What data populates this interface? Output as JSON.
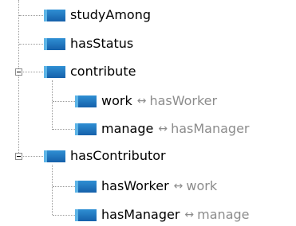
{
  "tree": {
    "inverse_arrow": "↔",
    "items": [
      {
        "label": "studyAmong"
      },
      {
        "label": "hasStatus"
      },
      {
        "label": "contribute",
        "expanded": true,
        "children": [
          {
            "label": "work",
            "inverse": "hasWorker"
          },
          {
            "label": "manage",
            "inverse": "hasManager"
          }
        ]
      },
      {
        "label": "hasContributor",
        "expanded": true,
        "children": [
          {
            "label": "hasWorker",
            "inverse": "work"
          },
          {
            "label": "hasManager",
            "inverse": "manage"
          }
        ]
      }
    ]
  },
  "colors": {
    "icon_fill": "#1f74c1",
    "icon_highlight": "#5db4e6",
    "tree_lines": "#9a9a9a",
    "inverse_text": "#8c8c8c"
  }
}
